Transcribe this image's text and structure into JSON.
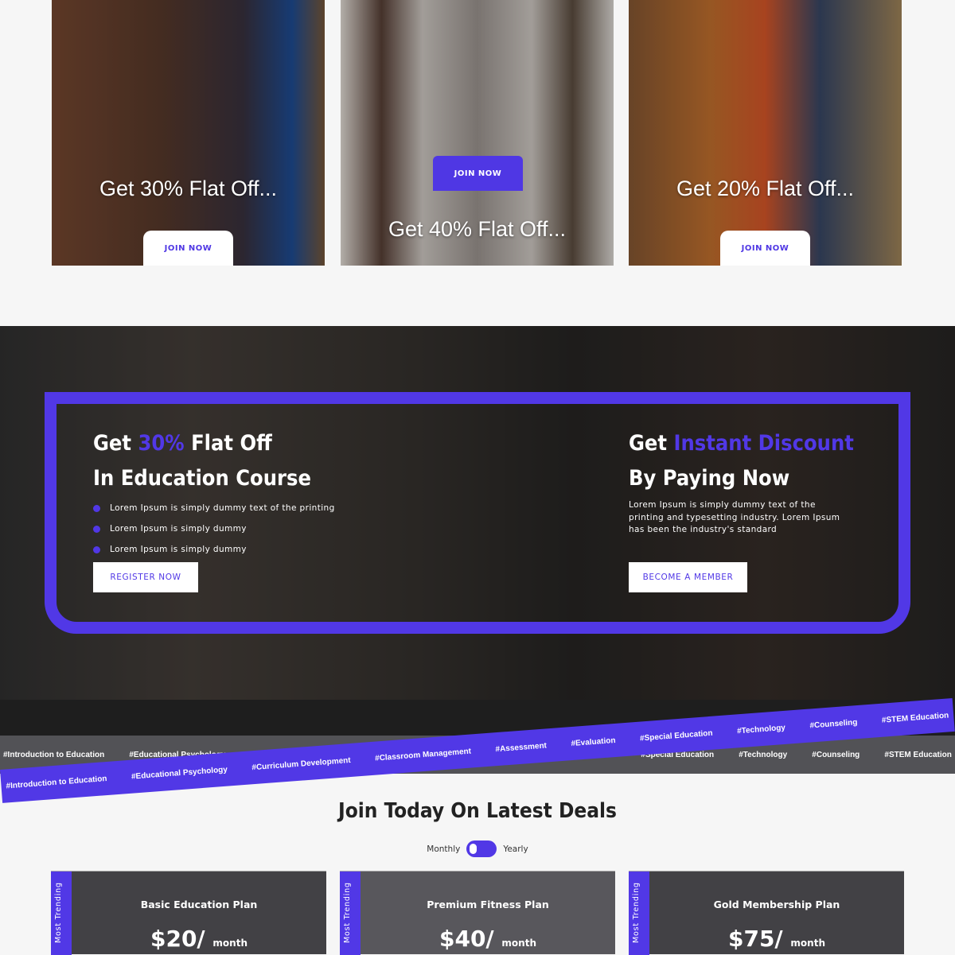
{
  "offers": [
    {
      "title": "Get 30% Flat Off...",
      "button": "JOIN NOW"
    },
    {
      "title": "Get 40% Flat Off...",
      "button": "JOIN NOW"
    },
    {
      "title": "Get 20% Flat Off...",
      "button": "JOIN NOW"
    }
  ],
  "banner": {
    "left": {
      "line1_pre": "Get ",
      "line1_accent": "30%",
      "line1_post": " Flat Off",
      "line2": "In Education Course",
      "bullets": [
        "Lorem Ipsum is simply dummy text of the printing",
        "Lorem Ipsum is simply dummy",
        "Lorem Ipsum is simply dummy"
      ],
      "button": "REGISTER NOW"
    },
    "right": {
      "line1_pre": "Get ",
      "line1_accent": "Instant Discount",
      "line2": "By Paying Now",
      "text": "Lorem Ipsum is simply dummy text of the printing and typesetting industry. Lorem Ipsum has been the industry's standard",
      "button": "BECOME A MEMBER"
    }
  },
  "tags": [
    "#Introduction to Education",
    "#Educational Psychology",
    "#Curriculum Development",
    "#Classroom Management",
    "#Assessment",
    "#Evaluation",
    "#Special Education",
    "#Technology",
    "#Counseling",
    "#STEM Education"
  ],
  "deals": {
    "heading": "Join Today On Latest Deals",
    "monthly": "Monthly",
    "yearly": "Yearly",
    "toggle_yearly": true,
    "plans": [
      {
        "ribbon": "Most Trending",
        "name": "Basic Education Plan",
        "price": "$20/",
        "period": "month"
      },
      {
        "ribbon": "Most Trending",
        "name": "Premium Fitness Plan",
        "price": "$40/",
        "period": "month"
      },
      {
        "ribbon": "Most Trending",
        "name": "Gold Membership Plan",
        "price": "$75/",
        "period": "month"
      }
    ]
  },
  "colors": {
    "accent": "#5138e6"
  }
}
